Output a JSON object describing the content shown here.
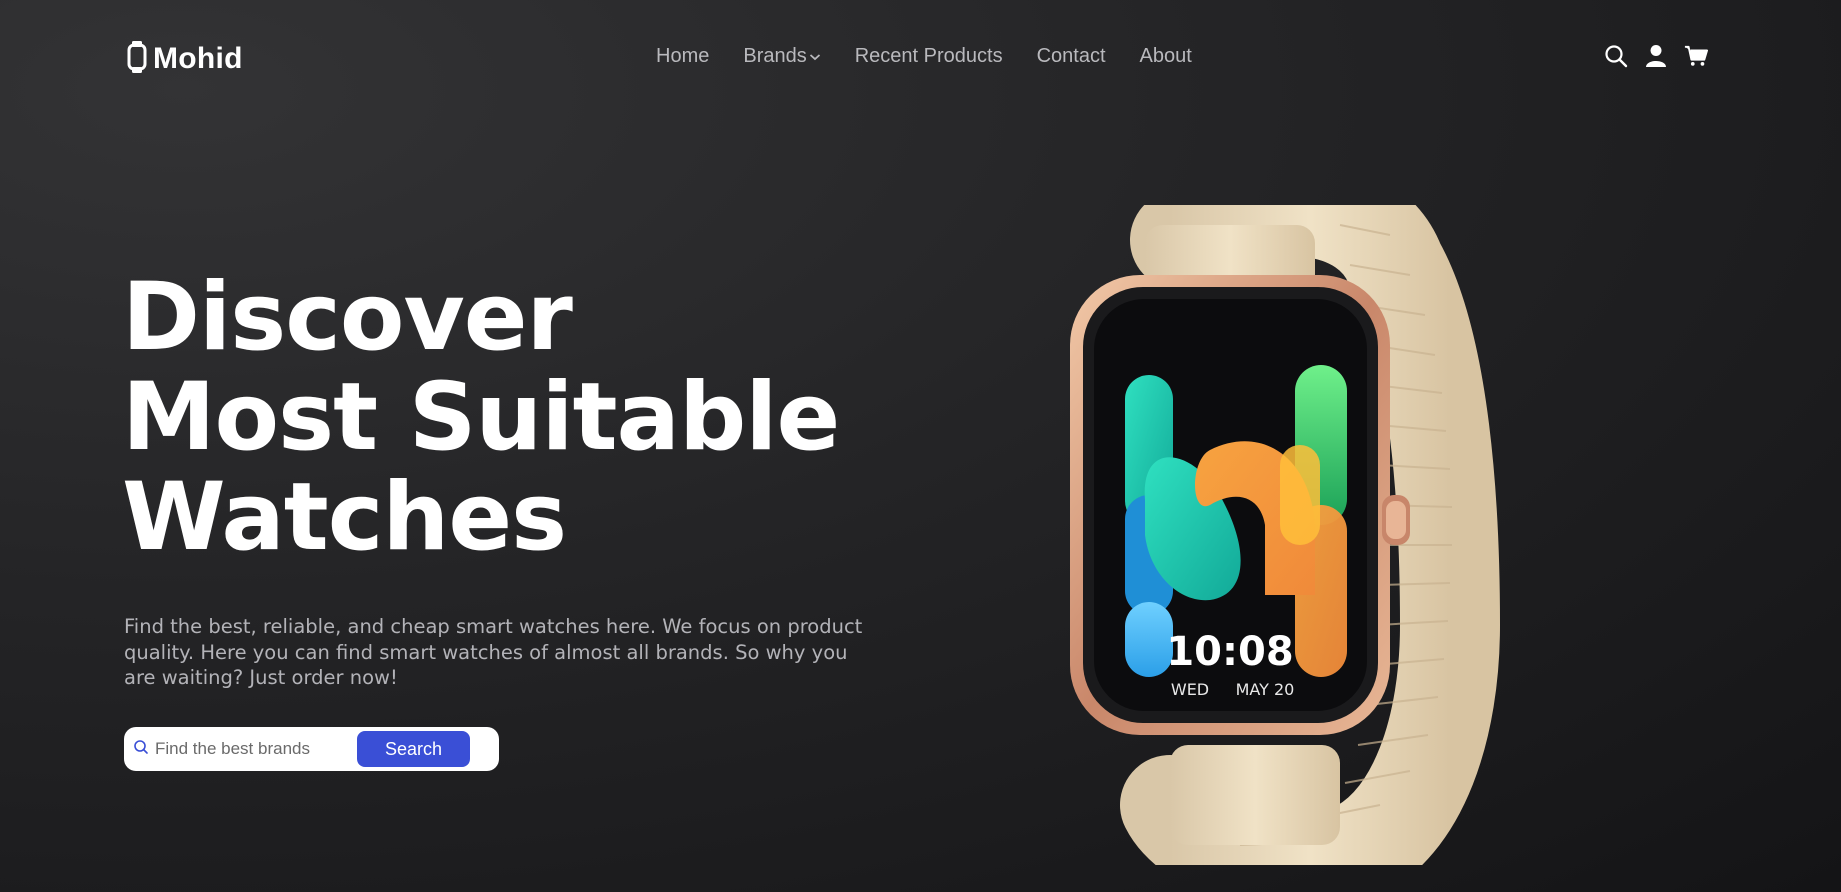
{
  "brand": {
    "name": "Mohid",
    "logo_icon": "watch-icon"
  },
  "nav": {
    "links": [
      {
        "label": "Home"
      },
      {
        "label": "Brands",
        "has_dropdown": true
      },
      {
        "label": "Recent Products"
      },
      {
        "label": "Contact"
      },
      {
        "label": "About"
      }
    ],
    "icons": [
      "search-icon",
      "user-icon",
      "cart-icon"
    ]
  },
  "hero": {
    "title_lines": [
      "Discover",
      "Most Suitable",
      "Watches"
    ],
    "description": "Find the best, reliable, and cheap smart watches here. We focus on product quality. Here you can find smart watches of almost all brands. So why you are waiting? Just order now!",
    "search": {
      "placeholder": "Find the best brands",
      "button_label": "Search"
    }
  },
  "watch_image": {
    "time": "10:08",
    "day": "WED",
    "date": "MAY 20"
  },
  "colors": {
    "accent": "#3a4fd6",
    "background": "#242426",
    "nav_text": "#b9b9bd"
  }
}
